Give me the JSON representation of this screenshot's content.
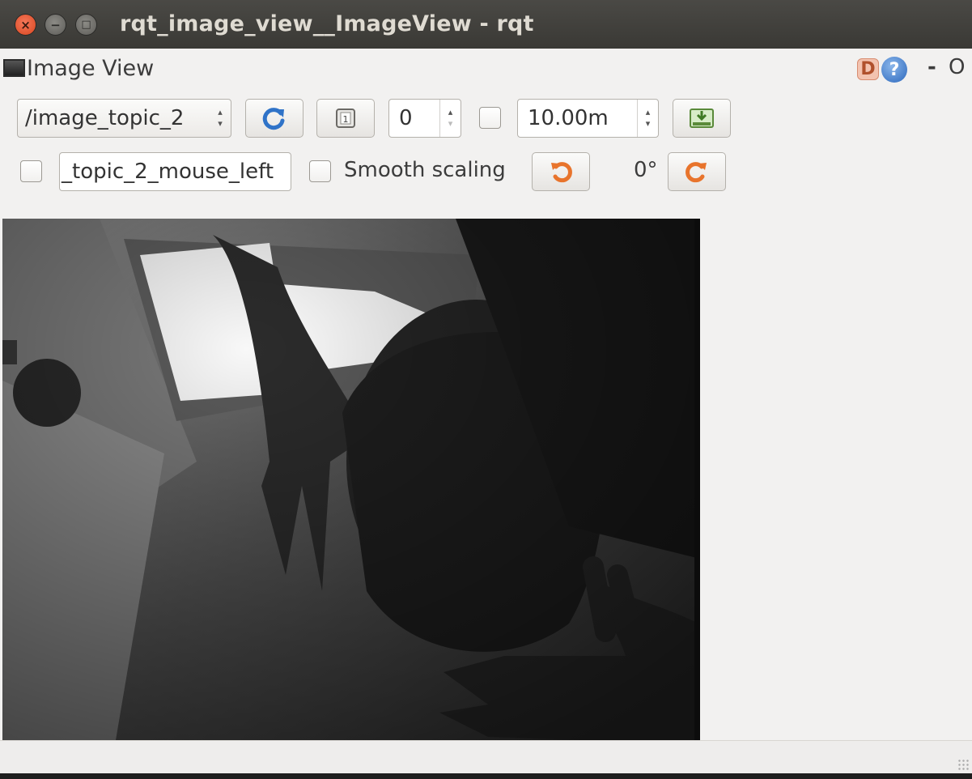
{
  "window": {
    "title": "rqt_image_view__ImageView - rqt",
    "buttons": [
      "close",
      "minimize",
      "maximize"
    ]
  },
  "plugin": {
    "title": "Image View",
    "help_icon": "help-icon",
    "d_label": "D",
    "minimize_label": "-",
    "close_label": "O"
  },
  "toolbar": {
    "topic_value": "/image_topic_2",
    "refresh_icon": "refresh-icon",
    "zoom_icon": "zoom-1-icon",
    "number_value": "0",
    "dynamic_range_checked": false,
    "max_depth_value": "10.00m",
    "save_icon": "save-icon"
  },
  "toolbar2": {
    "publish_checked": false,
    "mouse_topic_value": "_topic_2_mouse_left",
    "smooth_checked": false,
    "smooth_label": "Smooth scaling",
    "rotate_left_icon": "rotate-left-icon",
    "rotation_value": "0°",
    "rotate_right_icon": "rotate-right-icon"
  },
  "colors": {
    "titlebar": "#3d3c38",
    "window_bg": "#f2f1f0",
    "close_button": "#e3532d",
    "accent_orange": "#e8742c",
    "accent_blue": "#2f73c8"
  }
}
